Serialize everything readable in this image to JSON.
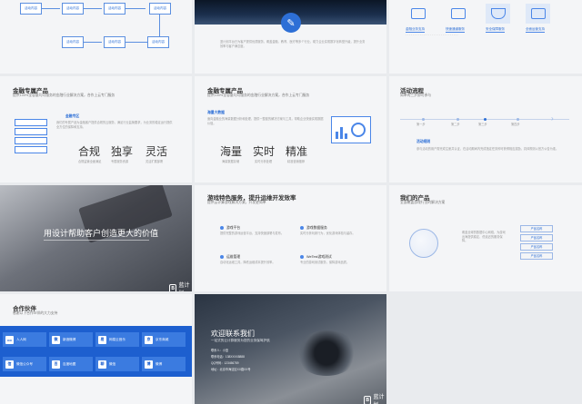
{
  "row1": {
    "flow_boxes": [
      "活动内容",
      "活动内容",
      "活动内容",
      "活动内容",
      "活动内容",
      "活动内容"
    ],
    "mid_text": "蓝计划平台已为客户提供优质服务，覆盖金融、教育、医疗等多个行业，助力企业实现数字化转型升级，提升业务效率与客户满意度。",
    "right_labels": [
      "金融业务支持",
      "快速通道服务",
      "安全保障服务",
      "全面运营支持"
    ]
  },
  "t4": {
    "title": "金融专属产品",
    "sub": "提供100%全容量均可服务的金融行业解决方案，合作上云专门服务",
    "heading": "金融专区",
    "body": "我们的专属产品为金融客户提供合规的云服务，满足行业监管要求，为业务的稳定运行提供全方位的保障和支持。",
    "words": [
      {
        "word": "合规",
        "sub": "合规监管全面满足"
      },
      {
        "word": "独享",
        "sub": "专属服务资源"
      },
      {
        "word": "灵活",
        "sub": "灵活扩展部署"
      }
    ]
  },
  "t5": {
    "title": "金融专属产品",
    "sub": "提供100%全容量均可服务的金融行业解决方案，合作上云专门服务",
    "heading": "海量大数据",
    "body": "面向金融业的海量数据分析和处理，提供一整套的解决方案与工具，帮助企业快速实现数据价值。",
    "words": [
      {
        "word": "海量",
        "sub": "海量数据存储"
      },
      {
        "word": "实时",
        "sub": "实时分析处理"
      },
      {
        "word": "精准",
        "sub": "精准营销推荐"
      }
    ]
  },
  "t6": {
    "title": "活动流程",
    "sub": "简单的三步即可参与",
    "steps": [
      "第一步",
      "第二步",
      "第三步",
      "第四步"
    ],
    "heading": "活动规则",
    "body": "参与活动的用户需完成注册并认证，在活动期间内完成指定任务即可获得相应奖励，具体规则以官方公告为准。"
  },
  "t7": {
    "banner": "用设计帮助客户创造更大的价值",
    "brand": "蓝计划"
  },
  "t8": {
    "title": "游戏特色服务，提升运维开发效率",
    "sub": "提供云计算游戏解决方案，开发更简单",
    "items": [
      {
        "name": "游戏平台",
        "desc": "提供完整的游戏运营平台，支持快速部署与发布。"
      },
      {
        "name": "游戏数据服务",
        "desc": "实时分析玩家行为，优化游戏体验与留存。"
      },
      {
        "name": "运维管理",
        "desc": "自动化运维工具，降低运维成本提升效率。"
      },
      {
        "name": "WeTest游戏测试",
        "desc": "专业的游戏测试服务，保障游戏品质。"
      }
    ]
  },
  "t9": {
    "title": "我们的产品",
    "sub": "全面覆盖游戏行业的解决方案",
    "items": [
      "产品名称",
      "产品名称",
      "产品名称",
      "产品名称"
    ],
    "body": "覆盖全球的数据中心网络，为游戏出海提供稳定、低延迟的服务保障。"
  },
  "t10": {
    "title": "合作伙伴",
    "sub": "感谢以下合作伙伴的大力支持",
    "partners": [
      {
        "icon": "co",
        "name": "人人网",
        "desc": "社交平台"
      },
      {
        "icon": "微",
        "name": "新浪微博",
        "desc": "社交媒体"
      },
      {
        "icon": "易",
        "name": "网易云音乐",
        "desc": "音乐平台"
      },
      {
        "icon": "京",
        "name": "京东商城",
        "desc": "电商平台"
      },
      {
        "icon": "信",
        "name": "微信公众号",
        "desc": "社交平台"
      },
      {
        "icon": "百",
        "name": "百度地图",
        "desc": "地图服务"
      },
      {
        "icon": "聊",
        "name": "微信",
        "desc": "即时通讯"
      },
      {
        "icon": "博",
        "name": "微博",
        "desc": "社交媒体"
      }
    ]
  },
  "t11": {
    "title": "欢迎联系我们",
    "sub": "一站式的云计算服务为您的业务保驾护航",
    "contacts": [
      "联系人：小蓝",
      "联系电话：138XXXX8888",
      "QQ号码：123456789",
      "地址：北京市海淀区XX路XX号"
    ],
    "brand": "蓝计划"
  }
}
